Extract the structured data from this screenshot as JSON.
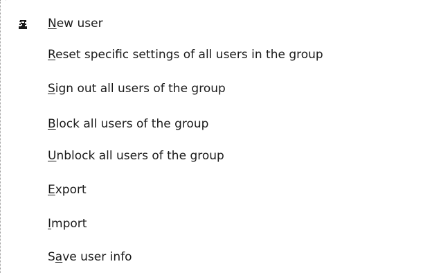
{
  "menu": {
    "items": [
      {
        "label": "New user",
        "accel_index": 0,
        "icon": "user-icon"
      },
      {
        "label": "Reset specific settings of all users in the group",
        "accel_index": 0
      },
      {
        "label": "Sign out all users of the group",
        "accel_index": 0
      },
      {
        "label": "Block all users of the group",
        "accel_index": 0
      },
      {
        "label": "Unblock all users of the group",
        "accel_index": 0
      },
      {
        "label": "Export",
        "accel_index": 0
      },
      {
        "label": "Import",
        "accel_index": 0
      },
      {
        "label": "Save user info",
        "accel_index": 1
      }
    ]
  }
}
